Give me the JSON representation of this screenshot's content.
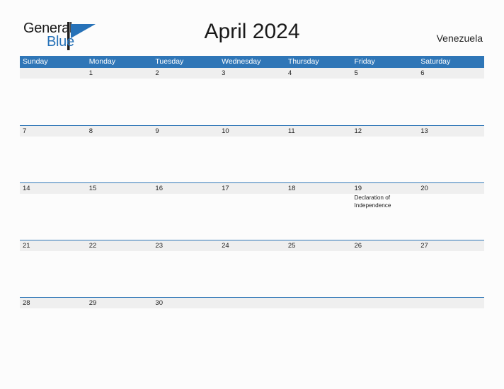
{
  "brand": {
    "name_part1": "General",
    "name_part2": "Blue",
    "flag_icon": "triangle-flag-icon",
    "color_primary": "#2772b8",
    "color_dark": "#1a1a1a"
  },
  "header": {
    "title": "April 2024",
    "country": "Venezuela",
    "accent_color": "#2f76b7",
    "band_color": "#efefef"
  },
  "calendar": {
    "weekdays": [
      "Sunday",
      "Monday",
      "Tuesday",
      "Wednesday",
      "Thursday",
      "Friday",
      "Saturday"
    ],
    "weeks": [
      [
        {
          "day": "",
          "events": []
        },
        {
          "day": "1",
          "events": []
        },
        {
          "day": "2",
          "events": []
        },
        {
          "day": "3",
          "events": []
        },
        {
          "day": "4",
          "events": []
        },
        {
          "day": "5",
          "events": []
        },
        {
          "day": "6",
          "events": []
        }
      ],
      [
        {
          "day": "7",
          "events": []
        },
        {
          "day": "8",
          "events": []
        },
        {
          "day": "9",
          "events": []
        },
        {
          "day": "10",
          "events": []
        },
        {
          "day": "11",
          "events": []
        },
        {
          "day": "12",
          "events": []
        },
        {
          "day": "13",
          "events": []
        }
      ],
      [
        {
          "day": "14",
          "events": []
        },
        {
          "day": "15",
          "events": []
        },
        {
          "day": "16",
          "events": []
        },
        {
          "day": "17",
          "events": []
        },
        {
          "day": "18",
          "events": []
        },
        {
          "day": "19",
          "events": [
            "Declaration of Independence"
          ]
        },
        {
          "day": "20",
          "events": []
        }
      ],
      [
        {
          "day": "21",
          "events": []
        },
        {
          "day": "22",
          "events": []
        },
        {
          "day": "23",
          "events": []
        },
        {
          "day": "24",
          "events": []
        },
        {
          "day": "25",
          "events": []
        },
        {
          "day": "26",
          "events": []
        },
        {
          "day": "27",
          "events": []
        }
      ],
      [
        {
          "day": "28",
          "events": []
        },
        {
          "day": "29",
          "events": []
        },
        {
          "day": "30",
          "events": []
        },
        {
          "day": "",
          "events": []
        },
        {
          "day": "",
          "events": []
        },
        {
          "day": "",
          "events": []
        },
        {
          "day": "",
          "events": []
        }
      ]
    ]
  }
}
